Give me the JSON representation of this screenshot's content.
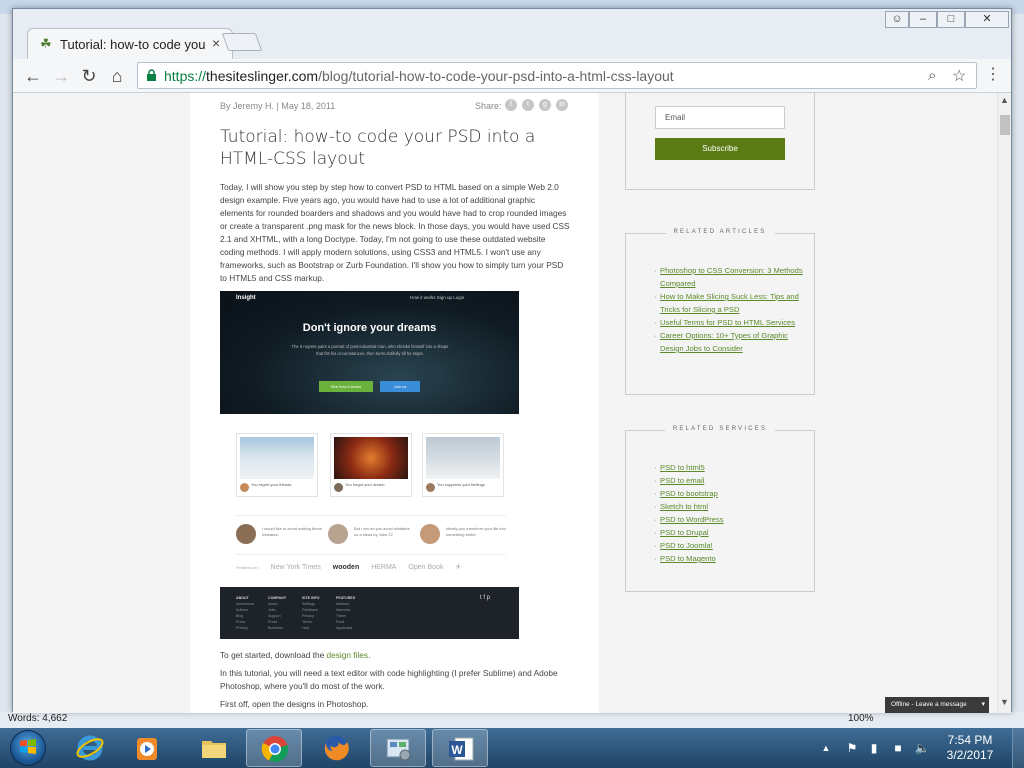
{
  "word_status": {
    "words": "Words: 4,662",
    "zoom": "100%"
  },
  "tab": {
    "title": "Tutorial: how-to code your PSD into a HTML-CSS layout",
    "close": "×"
  },
  "window_buttons": {
    "user": "☺",
    "minimize": "–",
    "restore": "□",
    "close": "✕"
  },
  "nav": {
    "back": "←",
    "forward": "→",
    "reload": "↻",
    "home": "⌂"
  },
  "address": {
    "protocol": "https://",
    "host": "thesiteslinger.com",
    "path": "/blog/tutorial-how-to-code-your-psd-into-a-html-css-layout"
  },
  "icons": {
    "zoom": "⌕",
    "star": "☆",
    "menu": "⋮"
  },
  "article": {
    "byline": "By Jeremy H. | May 18, 2011",
    "share_label": "Share:",
    "share_icons": [
      "f",
      "t",
      "g",
      "in"
    ],
    "title": "Tutorial: how-to code your PSD into a HTML-CSS layout",
    "intro": "Today, I will show you step by step how to convert PSD to HTML based on a simple Web 2.0 design example. Five years ago, you would have had to use a lot of additional graphic elements for rounded boarders and shadows and you would have had to crop rounded images or create a transparent .png mask for the news block. In those days, you would have used CSS 2.1 and XHTML, with a long Doctype. Today, I'm not going to use these outdated website coding methods. I will apply modern solutions, using CSS3 and HTML5. I won't use any frameworks, such as Bootstrap or Zurb Foundation. I'll show you how to simply turn your PSD to HTML5 and CSS markup.",
    "preview": {
      "logo": "Insight",
      "nav_links": "How it works   Sign up   Login",
      "headline": "Don't ignore your dreams",
      "subtext": "The 5 regrets paint a portrait of post-industrial man, who shrinks himself into a shape that fits his circumstances, then turns dutifully till he stops.",
      "btn_primary": "See how it works",
      "btn_secondary": "Join us",
      "cards": [
        {
          "caption": "You regret your friends"
        },
        {
          "caption": "You forgot your dream"
        },
        {
          "caption": "You suppress your feelings"
        }
      ],
      "quotes": [
        "I would like to avoid making these mistakes.",
        "But I am do you avoid mistakes so a ideas by Jobs 22",
        "Ideally you transform your life into something better"
      ],
      "logos": [
        "Featured on:",
        "New York Times",
        "wooden",
        "HERMA",
        "Open Book",
        "✈"
      ],
      "footer_cols": [
        {
          "head": "ABOUT",
          "items": [
            "Adventures",
            "Authors",
            "Blog",
            "Press",
            "Privacy"
          ]
        },
        {
          "head": "COMPANY",
          "items": [
            "About",
            "Jobs",
            "Support",
            "Press",
            "Business"
          ]
        },
        {
          "head": "SITE INFO",
          "items": [
            "Settings",
            "Feedback",
            "Privacy",
            "Terms",
            "Help"
          ]
        },
        {
          "head": "FEATURED",
          "items": [
            "Abstract",
            "Interview",
            "Travel",
            "Food",
            "Apparatus"
          ]
        }
      ],
      "footer_social": "t  f  p"
    },
    "p1_prefix": "To get started, download the ",
    "p1_link": "design files",
    "p1_suffix": ".",
    "p2": "In this tutorial, you will need a text editor with code highlighting (I prefer Sublime) and Adobe Photoshop, where you'll do most of the work.",
    "p3": "First off, open the designs in Photoshop."
  },
  "sidebar": {
    "email_placeholder": "Email",
    "subscribe_label": "Subscribe",
    "related_articles_heading": "RELATED ARTICLES",
    "related_articles": [
      "Photoshop to CSS Conversion: 3 Methods Compared",
      "How to Make Slicing Suck Less: Tips and Tricks for Slicing a PSD",
      "Useful Terms for PSD to HTML Services",
      "Career Options: 10+ Types of Graphic Design Jobs to Consider"
    ],
    "related_services_heading": "RELATED SERVICES",
    "related_services": [
      "PSD to html5",
      "PSD to email",
      "PSD to bootstrap",
      "Sketch to html",
      "PSD to WordPress",
      "PSD to Drupal",
      "PSD to Joomla!",
      "PSD to Magento"
    ]
  },
  "livechat": {
    "label": "Offline - Leave a message"
  },
  "taskbar": {
    "apps": [
      "Internet Explorer",
      "Media Player",
      "Windows Explorer",
      "Google Chrome",
      "Firefox",
      "Control Panel",
      "Microsoft Word"
    ],
    "clock_time": "7:54 PM",
    "clock_date": "3/2/2017"
  },
  "colors": {
    "accent_green": "#5a7a14",
    "link_green": "#5a8a2a",
    "secure_green": "#0b8043",
    "taskbar": "#2b5a82"
  }
}
